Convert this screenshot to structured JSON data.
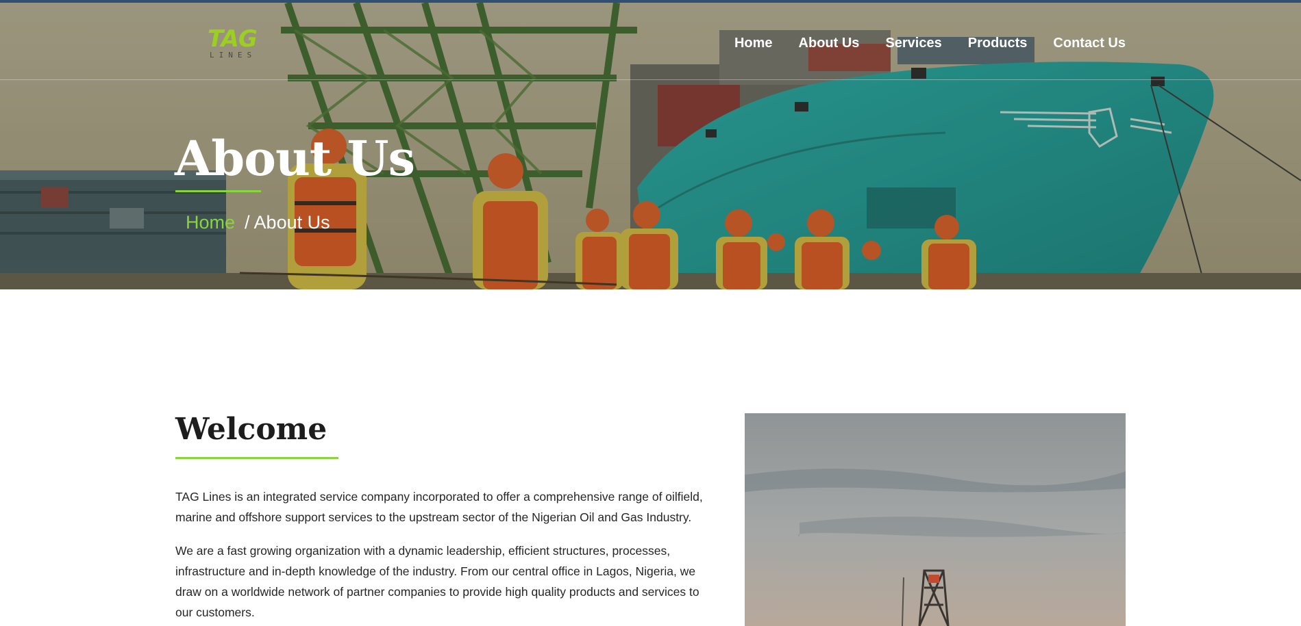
{
  "header": {
    "logo": {
      "mark": "TAG",
      "sub": "LINES"
    },
    "nav": [
      {
        "label": "Home"
      },
      {
        "label": "About Us"
      },
      {
        "label": "Services"
      },
      {
        "label": "Products"
      },
      {
        "label": "Contact Us"
      }
    ]
  },
  "hero": {
    "title": "About Us",
    "breadcrumb": {
      "home": "Home",
      "current": "/ About Us"
    }
  },
  "welcome": {
    "title": "Welcome",
    "paragraphs": [
      "TAG Lines is an integrated service company incorporated to offer a comprehensive range of oilfield, marine and offshore support services to the upstream sector of the Nigerian Oil and Gas Industry.",
      "We are a fast growing organization with a dynamic leadership, efficient structures, processes, infrastructure and in-depth knowledge of the industry. From our central office in Lagos, Nigeria, we draw on a worldwide network of partner companies to provide high quality products and services to our customers."
    ]
  },
  "colors": {
    "accent": "#86d63c",
    "logo": "#9ccf1f",
    "ship_hull": "#2aa39e",
    "top_strip": "#2f4f73"
  }
}
